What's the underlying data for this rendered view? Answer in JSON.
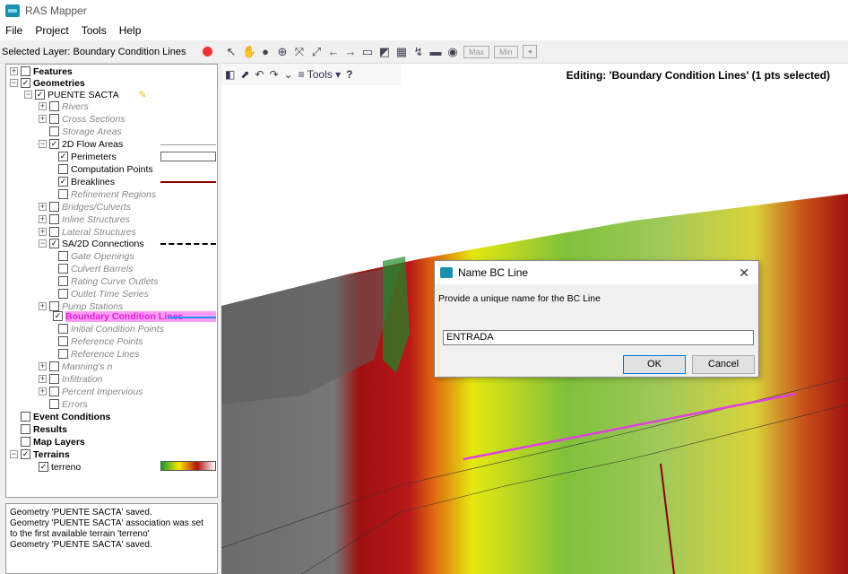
{
  "window": {
    "title": "RAS Mapper"
  },
  "menu": [
    "File",
    "Project",
    "Tools",
    "Help"
  ],
  "toolbar": {
    "selected_layer": "Selected Layer: Boundary Condition Lines",
    "max_label": "Max",
    "min_label": "Min"
  },
  "map_toolbar": {
    "tools_label": "Tools",
    "help_label": "?"
  },
  "editing_status": "Editing: 'Boundary Condition Lines' (1 pts selected)",
  "tree": [
    {
      "label": "Features",
      "bold": true
    },
    {
      "label": "Geometries",
      "bold": true
    },
    {
      "label": "PUENTE SACTA"
    },
    {
      "label": "Rivers"
    },
    {
      "label": "Cross Sections"
    },
    {
      "label": "Storage Areas"
    },
    {
      "label": "2D Flow Areas"
    },
    {
      "label": "Perimeters"
    },
    {
      "label": "Computation Points"
    },
    {
      "label": "Breaklines"
    },
    {
      "label": "Refinement Regions"
    },
    {
      "label": "Bridges/Culverts"
    },
    {
      "label": "Inline Structures"
    },
    {
      "label": "Lateral Structures"
    },
    {
      "label": "SA/2D Connections"
    },
    {
      "label": "Gate Openings"
    },
    {
      "label": "Culvert Barrels"
    },
    {
      "label": "Rating Curve Outlets"
    },
    {
      "label": "Outlet Time Series"
    },
    {
      "label": "Pump Stations"
    },
    {
      "label": "Boundary Condition Lines"
    },
    {
      "label": "Initial Condition Points"
    },
    {
      "label": "Reference Points"
    },
    {
      "label": "Reference Lines"
    },
    {
      "label": "Manning's n"
    },
    {
      "label": "Infiltration"
    },
    {
      "label": "Percent Impervious"
    },
    {
      "label": "Errors"
    },
    {
      "label": "Event Conditions",
      "bold": true
    },
    {
      "label": "Results",
      "bold": true
    },
    {
      "label": "Map Layers",
      "bold": true
    },
    {
      "label": "Terrains",
      "bold": true
    },
    {
      "label": "terreno"
    }
  ],
  "log": [
    "Geometry 'PUENTE SACTA' saved.",
    "Geometry 'PUENTE SACTA' association was set to the first available terrain 'terreno'",
    "Geometry 'PUENTE SACTA' saved."
  ],
  "dialog": {
    "title": "Name BC Line",
    "prompt": "Provide a unique name for the BC Line",
    "input_value": "ENTRADA",
    "ok_label": "OK",
    "cancel_label": "Cancel"
  },
  "colors": {
    "bc_line": "#e040e0",
    "breakline": "#8b0000",
    "selection": "#ff80ff"
  }
}
